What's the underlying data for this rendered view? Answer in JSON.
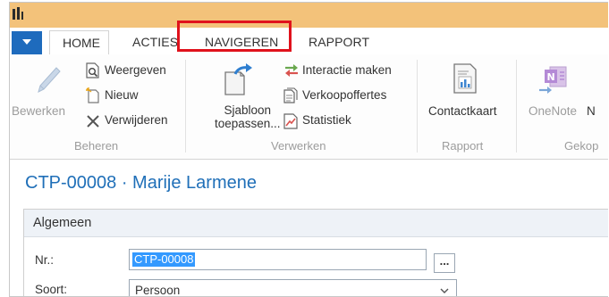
{
  "tabs": {
    "home": "HOME",
    "acties": "ACTIES",
    "navigeren": "NAVIGEREN",
    "rapport": "RAPPORT"
  },
  "ribbon": {
    "beheren": {
      "bewerken": "Bewerken",
      "weergeven": "Weergeven",
      "nieuw": "Nieuw",
      "verwijderen": "Verwijderen",
      "group_label": "Beheren"
    },
    "verwerken": {
      "sjabloon_line1": "Sjabloon",
      "sjabloon_line2": "toepassen...",
      "interactie": "Interactie maken",
      "verkoopoffertes": "Verkoopoffertes",
      "statistiek": "Statistiek",
      "group_label": "Verwerken"
    },
    "rapport": {
      "contactkaart": "Contactkaart",
      "group_label": "Rapport"
    },
    "gekop": {
      "onenote": "OneNote",
      "onenote_suffix": "N",
      "group_label": "Gekop"
    }
  },
  "page": {
    "title": "CTP-00008 · Marije Larmene",
    "fasttab_label": "Algemeen",
    "fields": {
      "nr_label": "Nr.:",
      "nr_value": "CTP-00008",
      "assist_label": "...",
      "soort_label": "Soort:",
      "soort_value": "Persoon"
    }
  },
  "colors": {
    "title_bar": "#f3c27a",
    "app_menu": "#1e6bbd",
    "highlight": "#e0121c",
    "page_title": "#1f6fb8",
    "selection": "#3399ff"
  },
  "icons": [
    "app-logo-icon",
    "menu-dropdown-icon",
    "pencil-icon",
    "view-icon",
    "new-doc-icon",
    "delete-x-icon",
    "template-icon",
    "interaction-icon",
    "quote-icon",
    "statistics-icon",
    "contact-card-icon",
    "onenote-icon",
    "chevron-down-icon"
  ]
}
